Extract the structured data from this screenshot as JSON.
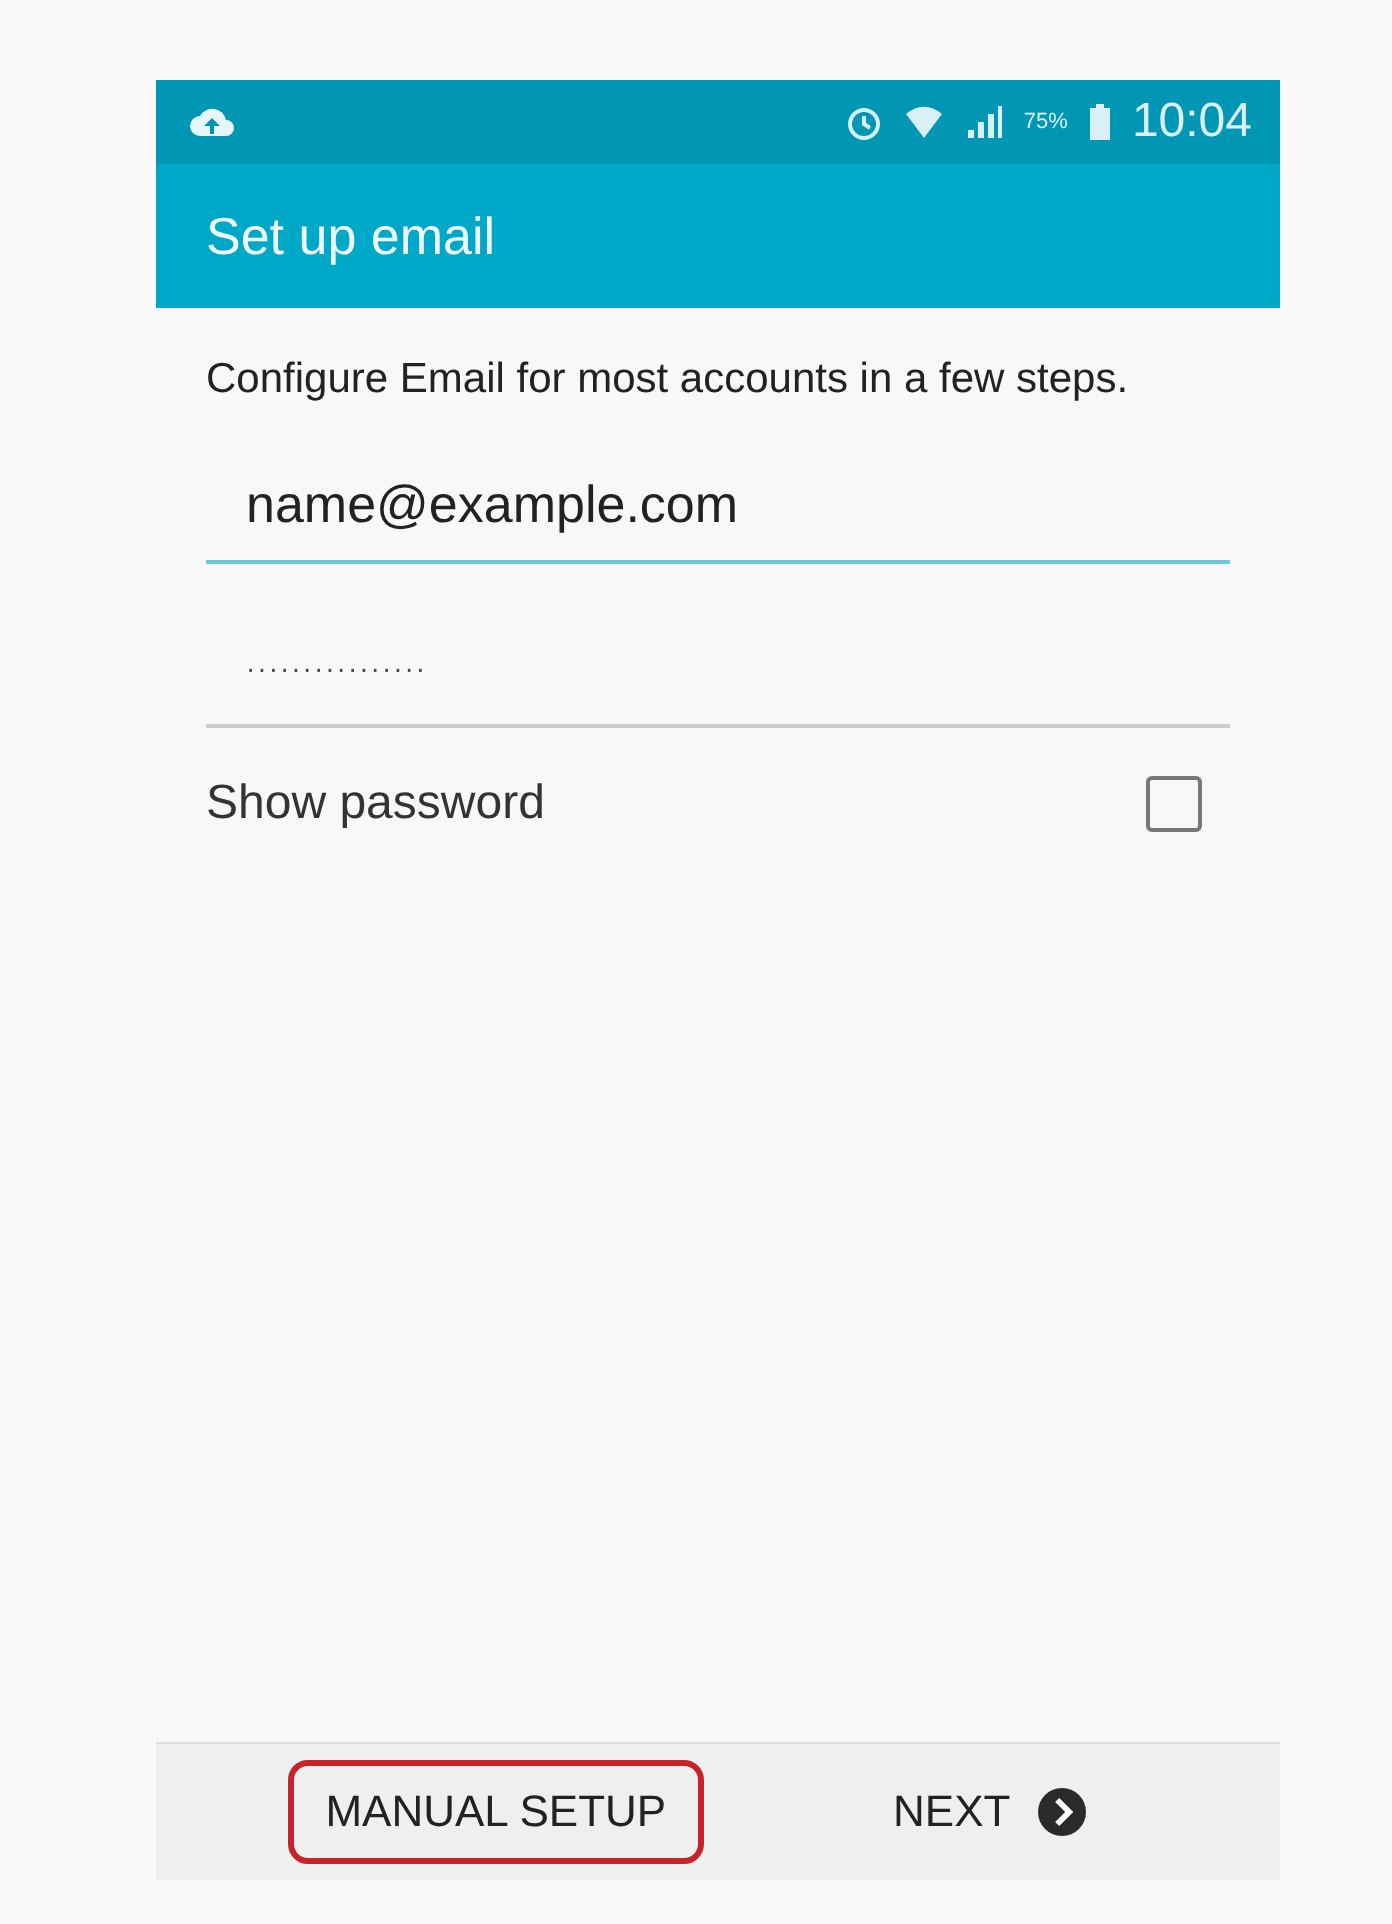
{
  "status_bar": {
    "battery": "75%",
    "time": "10:04"
  },
  "app_bar": {
    "title": "Set up email"
  },
  "intro": "Configure Email for most accounts in a few steps.",
  "fields": [
    {
      "kind": "email",
      "value": "name@example.com",
      "focused": true
    },
    {
      "kind": "password",
      "value": "················",
      "focused": false
    }
  ],
  "show_password": {
    "label": "Show password",
    "checked": false
  },
  "bottom_bar": {
    "buttons": [
      {
        "label": "MANUAL SETUP",
        "kind": "plain",
        "highlighted": true
      },
      {
        "label": "NEXT",
        "kind": "next",
        "highlighted": false
      }
    ]
  }
}
